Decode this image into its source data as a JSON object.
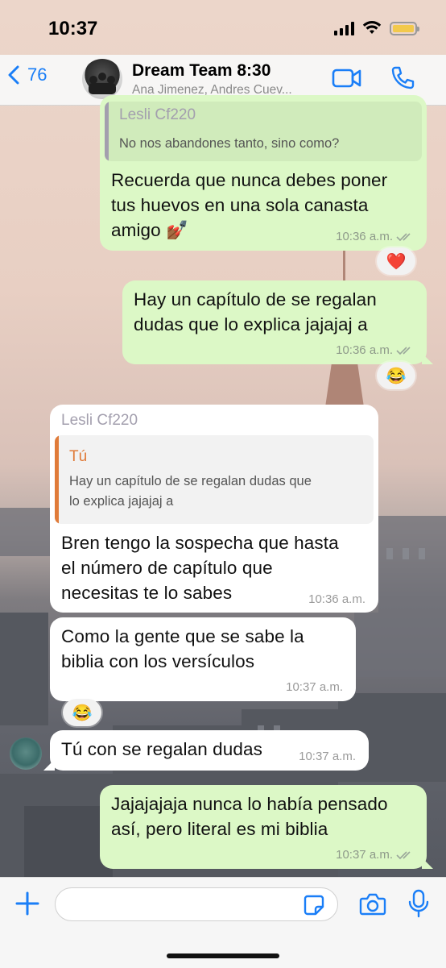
{
  "status_bar": {
    "time": "10:37"
  },
  "header": {
    "back_count": "76",
    "title": "Dream Team 8:30",
    "subtitle": "Ana Jimenez, Andres Cuev..."
  },
  "messages": [
    {
      "type": "outgoing",
      "quote": {
        "name": "Lesli Cf220",
        "text": "No nos abandones tanto, sino como?"
      },
      "text_lines": [
        "Recuerda que nunca debes poner",
        "tus huevos en una sola canasta",
        "amigo 💅🏾"
      ],
      "time": "10:36 a.m.",
      "reaction": "❤️"
    },
    {
      "type": "outgoing",
      "text_lines": [
        "Hay un capítulo de se regalan",
        "dudas que lo explica jajajaj a"
      ],
      "time": "10:36 a.m.",
      "reaction": "😂"
    },
    {
      "type": "incoming",
      "sender": "Lesli Cf220",
      "quote": {
        "name": "Tú",
        "text_lines": [
          "Hay un capítulo de se regalan dudas que",
          "lo explica jajajaj a"
        ]
      },
      "text_lines": [
        "Bren tengo la sospecha que hasta",
        "el número de capítulo que",
        "necesitas te lo sabes"
      ],
      "time": "10:36 a.m."
    },
    {
      "type": "incoming",
      "text_lines": [
        "Como la gente que se sabe la",
        "biblia con los versículos"
      ],
      "time": "10:37 a.m.",
      "reaction": "😂"
    },
    {
      "type": "incoming",
      "text": "Tú con se regalan dudas",
      "time": "10:37 a.m."
    },
    {
      "type": "outgoing",
      "text_lines": [
        "Jajajajaja nunca lo había pensado",
        "así, pero literal es mi biblia"
      ],
      "time": "10:37 a.m."
    }
  ],
  "input": {
    "placeholder": ""
  },
  "colors": {
    "accent": "#1a7ef7",
    "outgoing_bubble": "#dcf8c6",
    "incoming_bubble": "#ffffff",
    "quote_bar_other": "#a39fae",
    "quote_bar_you": "#e07b39",
    "read_ticks": "#9aa79a"
  }
}
